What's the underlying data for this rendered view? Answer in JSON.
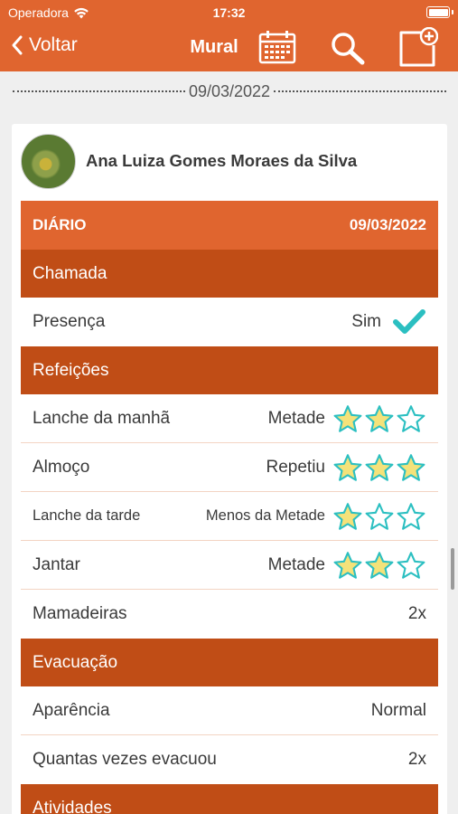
{
  "status_bar": {
    "carrier": "Operadora",
    "time": "17:32"
  },
  "nav": {
    "back_label": "Voltar",
    "title": "Mural"
  },
  "feed": {
    "date": "09/03/2022"
  },
  "post": {
    "author": "Ana Luiza Gomes Moraes da Silva",
    "diary": {
      "title": "DIÁRIO",
      "date": "09/03/2022",
      "sections": {
        "chamada": {
          "title": "Chamada",
          "presence_label": "Presença",
          "presence_value": "Sim"
        },
        "refeicoes": {
          "title": "Refeições",
          "items": [
            {
              "label": "Lanche da manhã",
              "value": "Metade",
              "stars": 2
            },
            {
              "label": "Almoço",
              "value": "Repetiu",
              "stars": 3
            },
            {
              "label": "Lanche da tarde",
              "value": "Menos da Metade",
              "stars": 1
            },
            {
              "label": "Jantar",
              "value": "Metade",
              "stars": 2
            }
          ],
          "bottles_label": "Mamadeiras",
          "bottles_value": "2x"
        },
        "evacuacao": {
          "title": "Evacuação",
          "appearance_label": "Aparência",
          "appearance_value": "Normal",
          "count_label": "Quantas vezes evacuou",
          "count_value": "2x"
        },
        "atividades": {
          "title": "Atividades"
        }
      }
    }
  },
  "colors": {
    "primary": "#e0652f",
    "section": "#c04d16",
    "star_fill": "#f4e27a",
    "star_outline": "#2bbfc1",
    "check": "#2bbfc1"
  },
  "icons": {
    "back": "chevron-left-icon",
    "calendar": "calendar-icon",
    "search": "search-icon",
    "new_post": "add-note-icon",
    "presence": "checkmark-icon",
    "rating": "star-icon"
  },
  "max_stars": 3
}
